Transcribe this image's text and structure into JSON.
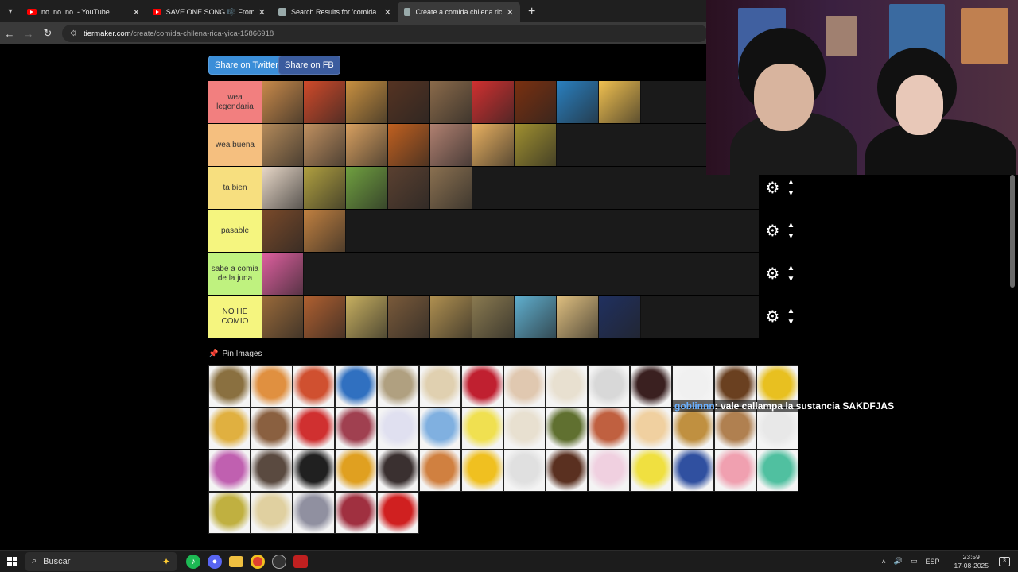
{
  "browser": {
    "tabs": [
      {
        "title": "no. no. no. - YouTube",
        "icon": "youtube-icon",
        "audio": false,
        "active": false
      },
      {
        "title": "SAVE ONE SONG 🎼 From A to",
        "icon": "youtube-icon",
        "audio": true,
        "active": false
      },
      {
        "title": "Search Results for 'comida chile",
        "icon": "tiermaker-icon",
        "audio": false,
        "active": false
      },
      {
        "title": "Create a comida chilena rica yic",
        "icon": "tiermaker-icon",
        "audio": false,
        "active": true
      }
    ],
    "url_host": "tiermaker.com",
    "url_path": "/create/comida-chilena-rica-yica-15866918"
  },
  "share": {
    "twitter_label": "Share on Twitter",
    "fb_label": "Share on FB"
  },
  "tiers": [
    {
      "label": "wea legendaria",
      "color": "#f27f7f",
      "items": [
        "#c98a4a",
        "#d04a2a",
        "#c89040",
        "#553322",
        "#8a6a4a",
        "#d03030",
        "#7a3010",
        "#2a80c0",
        "#f0c050"
      ]
    },
    {
      "label": "wea buena",
      "color": "#f5bf7f",
      "items": [
        "#b48a5a",
        "#c09060",
        "#d8a060",
        "#c06020",
        "#b08070",
        "#e8b060",
        "#a09030"
      ]
    },
    {
      "label": "ta bien",
      "color": "#f7df7f",
      "items": [
        "#e8d8c8",
        "#b0a040",
        "#70a040",
        "#5a4030",
        "#8a7050"
      ]
    },
    {
      "label": "pasable",
      "color": "#f5f57f",
      "items": [
        "#7a4a2a",
        "#c08040"
      ]
    },
    {
      "label": "sabe a comia de la juna",
      "color": "#bff27f",
      "items": [
        "#e060a0"
      ]
    },
    {
      "label": "NO HE COMIO",
      "color": "#f5f57f",
      "items": [
        "#9a6a3a",
        "#b06030",
        "#c8b060",
        "#7a5a3a",
        "#b09050",
        "#8a7a50",
        "#60b0d0",
        "#e0c080",
        "#203060"
      ]
    }
  ],
  "pin_images": {
    "title": "Pin Images",
    "items": [
      "#8a7040",
      "#e09040",
      "#d05030",
      "#3070c0",
      "#b0a080",
      "#e0d0b0",
      "#c02030",
      "#e0c8b0",
      "#e8e0d0",
      "#d8d8d8",
      "#3a2020",
      "#f0f0f0",
      "#6a4020",
      "#e8c020",
      "#e0b040",
      "#8a6040",
      "#d03030",
      "#a04050",
      "#e0e0f0",
      "#80b0e0",
      "#f0e050",
      "#e8e0d0",
      "#607030",
      "#c06040",
      "#f0d0a0",
      "#c09040",
      "#b08050",
      "#e8e8e8",
      "#c060b0",
      "#5a4a40",
      "#202020",
      "#e0a020",
      "#3a3030",
      "#d08040",
      "#f0c020",
      "#e0e0e0",
      "#5a3020",
      "#f0d0e0",
      "#f0e040",
      "#3050a0",
      "#f0a0b0",
      "#50c0a0",
      "#c0b040",
      "#e0d0a0",
      "#9090a0",
      "#a03040",
      "#d02020"
    ]
  },
  "chat": {
    "user": "goblinnn",
    "message": ": vale callampa la sustancia SAKDFJAS"
  },
  "taskbar": {
    "search_placeholder": "Buscar",
    "language": "ESP",
    "time": "23:59",
    "date": "17-08-2025",
    "notifications": "3"
  }
}
